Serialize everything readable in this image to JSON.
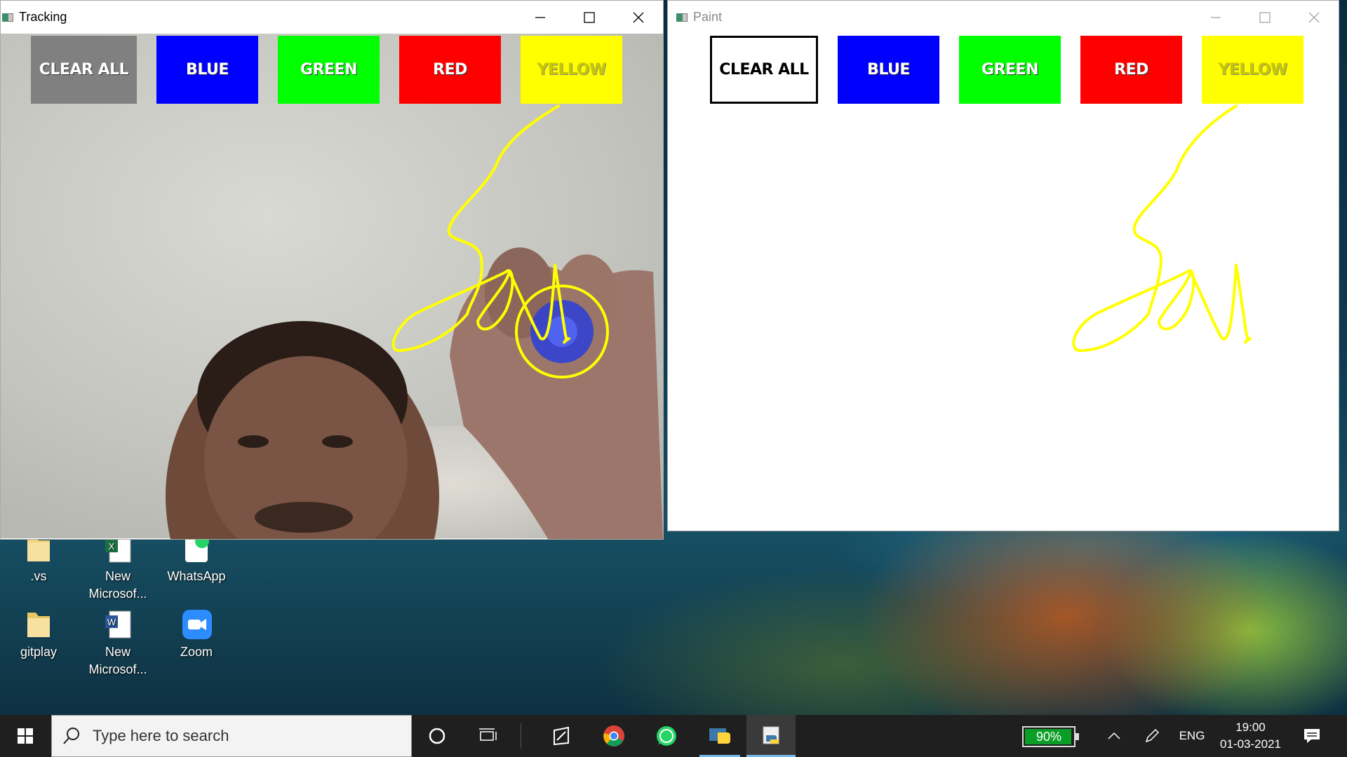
{
  "windows": {
    "tracking": {
      "title": "Tracking"
    },
    "paint": {
      "title": "Paint"
    }
  },
  "palette": {
    "clear_all": "CLEAR ALL",
    "blue": "BLUE",
    "green": "GREEN",
    "red": "RED",
    "yellow": "YELLOW"
  },
  "colors": {
    "blue": "#0000ff",
    "green": "#00ff00",
    "red": "#ff0000",
    "yellow": "#ffff00",
    "clear_tracking": "#808080",
    "stroke": "#ffff00",
    "marker": "#2b3ed8"
  },
  "desktop_icons": [
    {
      "label": ".vs",
      "icon": "folder-icon"
    },
    {
      "label": "New Microsof...",
      "icon": "excel-icon"
    },
    {
      "label": "WhatsApp",
      "icon": "whatsapp-icon"
    },
    {
      "label": "gitplay",
      "icon": "folder-icon"
    },
    {
      "label": "New Microsof...",
      "icon": "word-icon"
    },
    {
      "label": "Zoom",
      "icon": "zoom-icon"
    }
  ],
  "taskbar": {
    "search_placeholder": "Type here to search",
    "battery": "90%",
    "language": "ENG",
    "time": "19:00",
    "date": "01-03-2021"
  }
}
